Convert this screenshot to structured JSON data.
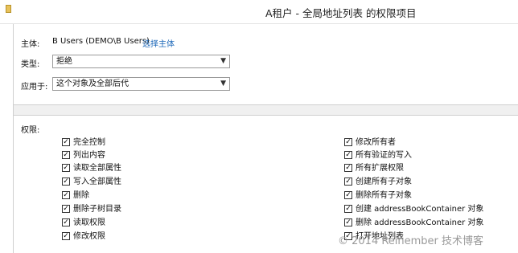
{
  "window": {
    "title": "A租户 - 全局地址列表 的权限项目",
    "folder_icon": "folder-icon"
  },
  "principal": {
    "label": "主体:",
    "value": "B Users (DEMO\\B Users)",
    "select_link": "选择主体"
  },
  "type": {
    "label": "类型:",
    "selected": "拒绝"
  },
  "applies_to": {
    "label": "应用于:",
    "selected": "这个对象及全部后代"
  },
  "permissions": {
    "label": "权限:",
    "left": [
      {
        "label": "完全控制",
        "checked": true
      },
      {
        "label": "列出内容",
        "checked": true
      },
      {
        "label": "读取全部属性",
        "checked": true
      },
      {
        "label": "写入全部属性",
        "checked": true
      },
      {
        "label": "删除",
        "checked": true
      },
      {
        "label": "删除子树目录",
        "checked": true
      },
      {
        "label": "读取权限",
        "checked": true
      },
      {
        "label": "修改权限",
        "checked": true
      }
    ],
    "right": [
      {
        "label": "修改所有者",
        "checked": true
      },
      {
        "label": "所有验证的写入",
        "checked": true
      },
      {
        "label": "所有扩展权限",
        "checked": true
      },
      {
        "label": "创建所有子对象",
        "checked": true
      },
      {
        "label": "删除所有子对象",
        "checked": true
      },
      {
        "label": "创建 addressBookContainer 对象",
        "checked": true
      },
      {
        "label": "删除 addressBookContainer 对象",
        "checked": true
      },
      {
        "label": "打开地址列表",
        "checked": true
      }
    ]
  },
  "watermark": "© 2014 Reinember 技术博客",
  "check_glyph": "✓"
}
